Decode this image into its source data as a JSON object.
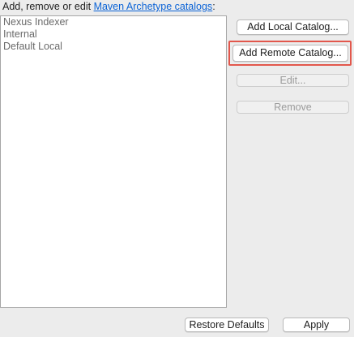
{
  "header": {
    "prefix": "Add, remove or edit ",
    "link_text": "Maven Archetype catalogs",
    "suffix": ":"
  },
  "catalogs": [
    {
      "label": "Nexus Indexer"
    },
    {
      "label": "Internal"
    },
    {
      "label": "Default Local"
    }
  ],
  "buttons": {
    "add_local": "Add Local Catalog...",
    "add_remote": "Add Remote Catalog...",
    "edit": "Edit...",
    "remove": "Remove",
    "restore_defaults": "Restore Defaults",
    "apply": "Apply"
  },
  "colors": {
    "highlight": "#e2574c",
    "link": "#0b63d6"
  }
}
